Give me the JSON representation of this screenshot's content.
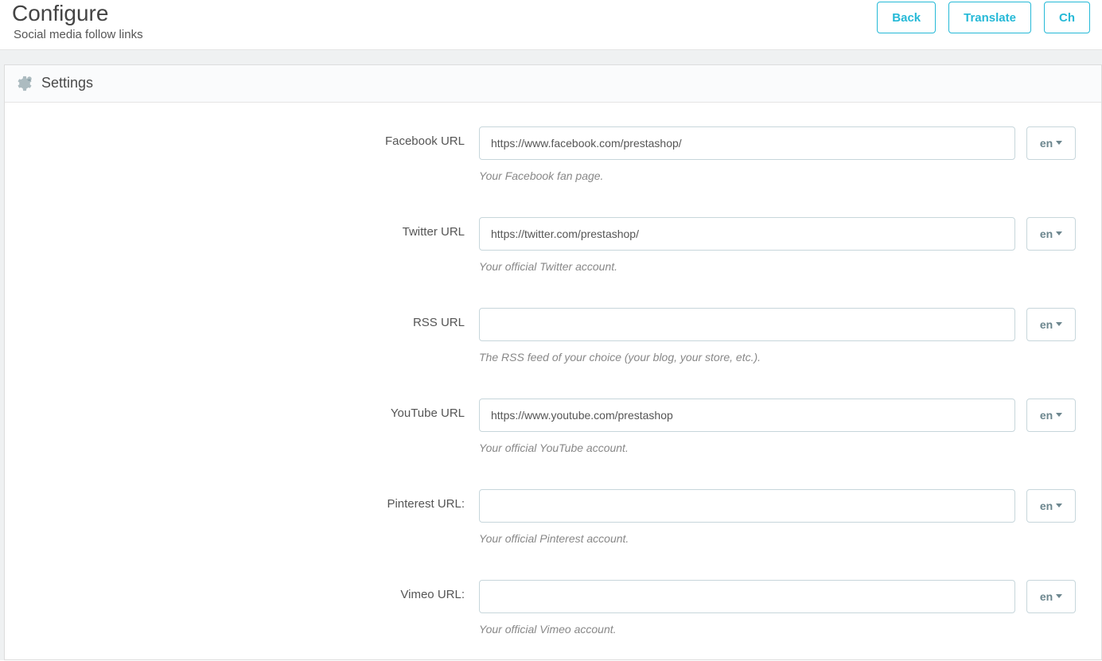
{
  "header": {
    "title": "Configure",
    "subtitle": "Social media follow links",
    "buttons": {
      "back": "Back",
      "translate": "Translate",
      "check_partial": "Ch"
    }
  },
  "panel": {
    "heading": "Settings"
  },
  "lang": "en",
  "fields": [
    {
      "id": "facebook",
      "label": "Facebook URL",
      "value": "https://www.facebook.com/prestashop/",
      "help": "Your Facebook fan page."
    },
    {
      "id": "twitter",
      "label": "Twitter URL",
      "value": "https://twitter.com/prestashop/",
      "help": "Your official Twitter account."
    },
    {
      "id": "rss",
      "label": "RSS URL",
      "value": "",
      "help": "The RSS feed of your choice (your blog, your store, etc.)."
    },
    {
      "id": "youtube",
      "label": "YouTube URL",
      "value": "https://www.youtube.com/prestashop",
      "help": "Your official YouTube account."
    },
    {
      "id": "pinterest",
      "label": "Pinterest URL:",
      "value": "",
      "help": "Your official Pinterest account."
    },
    {
      "id": "vimeo",
      "label": "Vimeo URL:",
      "value": "",
      "help": "Your official Vimeo account."
    }
  ]
}
